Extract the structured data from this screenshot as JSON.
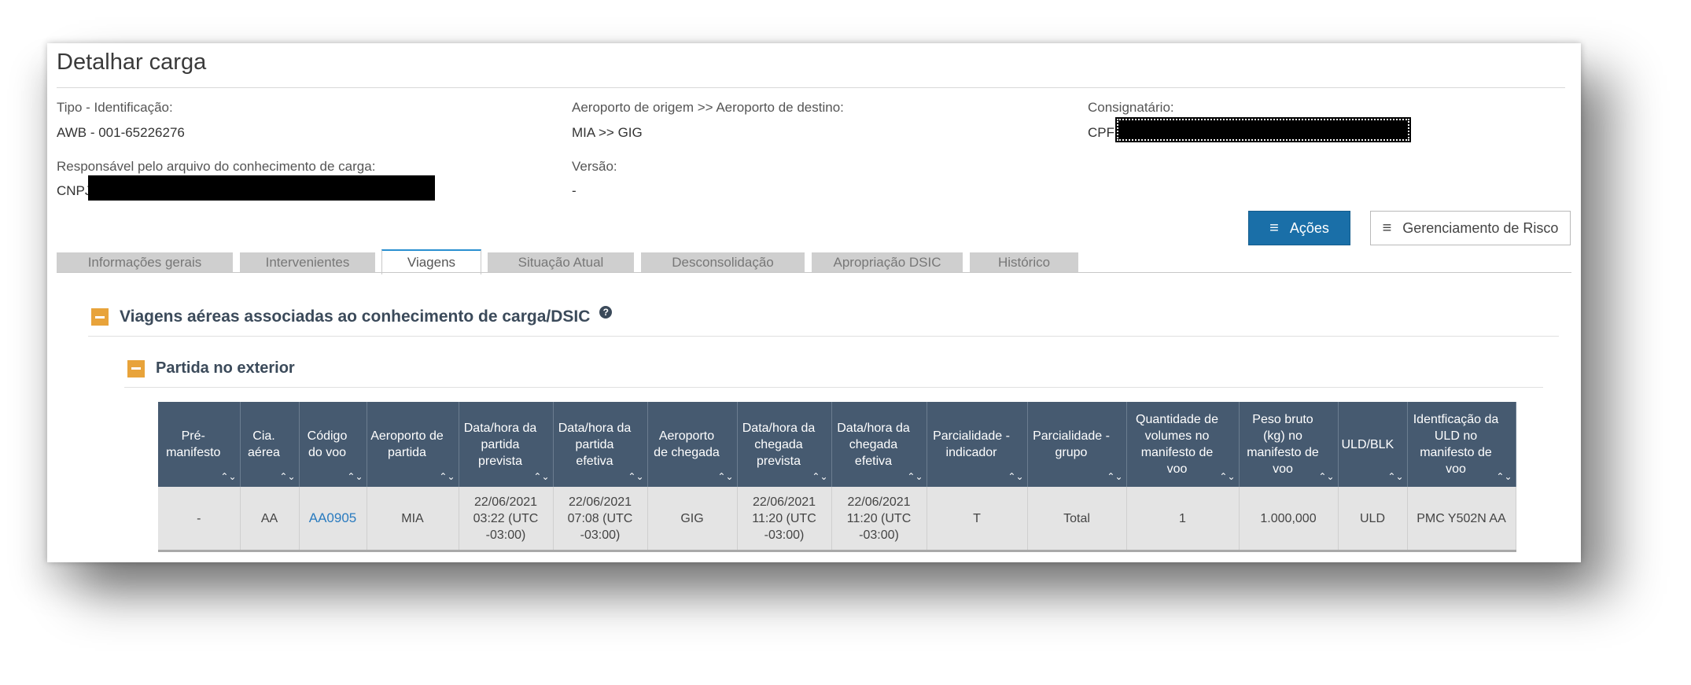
{
  "page_title": "Detalhar carga",
  "fields": {
    "tipo_label": "Tipo - Identificação:",
    "tipo_value": "AWB - 001-65226276",
    "aeroporto_label": "Aeroporto de origem >> Aeroporto de destino:",
    "aeroporto_value": "MIA >> GIG",
    "consignatario_label": "Consignatário:",
    "consignatario_prefix": "CPF",
    "responsavel_label": "Responsável pelo arquivo do conhecimento de carga:",
    "responsavel_prefix": "CNPJ",
    "versao_label": "Versão:",
    "versao_value": "-"
  },
  "buttons": {
    "acoes": "Ações",
    "gerenciamento": "Gerenciamento de Risco",
    "menu_glyph": "≡"
  },
  "tabs": [
    {
      "label": "Informações gerais",
      "active": false
    },
    {
      "label": "Intervenientes",
      "active": false
    },
    {
      "label": "Viagens",
      "active": true
    },
    {
      "label": "Situação Atual",
      "active": false
    },
    {
      "label": "Desconsolidação",
      "active": false
    },
    {
      "label": "Apropriação DSIC",
      "active": false
    },
    {
      "label": "Histórico",
      "active": false
    }
  ],
  "sections": {
    "viagens_title": "Viagens aéreas associadas ao conhecimento de carga/DSIC",
    "partida_title": "Partida no exterior"
  },
  "table": {
    "sort_glyph": "⌃⌄",
    "headers": [
      "Pré-manifesto",
      "Cia. aérea",
      "Código do voo",
      "Aeroporto de partida",
      "Data/hora da partida prevista",
      "Data/hora da partida efetiva",
      "Aeroporto de chegada",
      "Data/hora da chegada prevista",
      "Data/hora da chegada efetiva",
      "Parcialidade - indicador",
      "Parcialidade - grupo",
      "Quantidade de volumes no manifesto de voo",
      "Peso bruto (kg) no manifesto de voo",
      "ULD/BLK",
      "Identficação da ULD no manifesto de voo"
    ],
    "row": [
      "-",
      "AA",
      "AA0905",
      "MIA",
      "22/06/2021 03:22 (UTC -03:00)",
      "22/06/2021 07:08 (UTC -03:00)",
      "GIG",
      "22/06/2021 11:20 (UTC -03:00)",
      "22/06/2021 11:20 (UTC -03:00)",
      "T",
      "Total",
      "1",
      "1.000,000",
      "ULD",
      "PMC Y502N AA"
    ]
  },
  "colors": {
    "header_bg": "#465a70",
    "primary_button": "#1a6fa8",
    "collapse_icon": "#e8a33a",
    "link": "#2a7bbf",
    "annotation_arrow": "#e52016"
  }
}
